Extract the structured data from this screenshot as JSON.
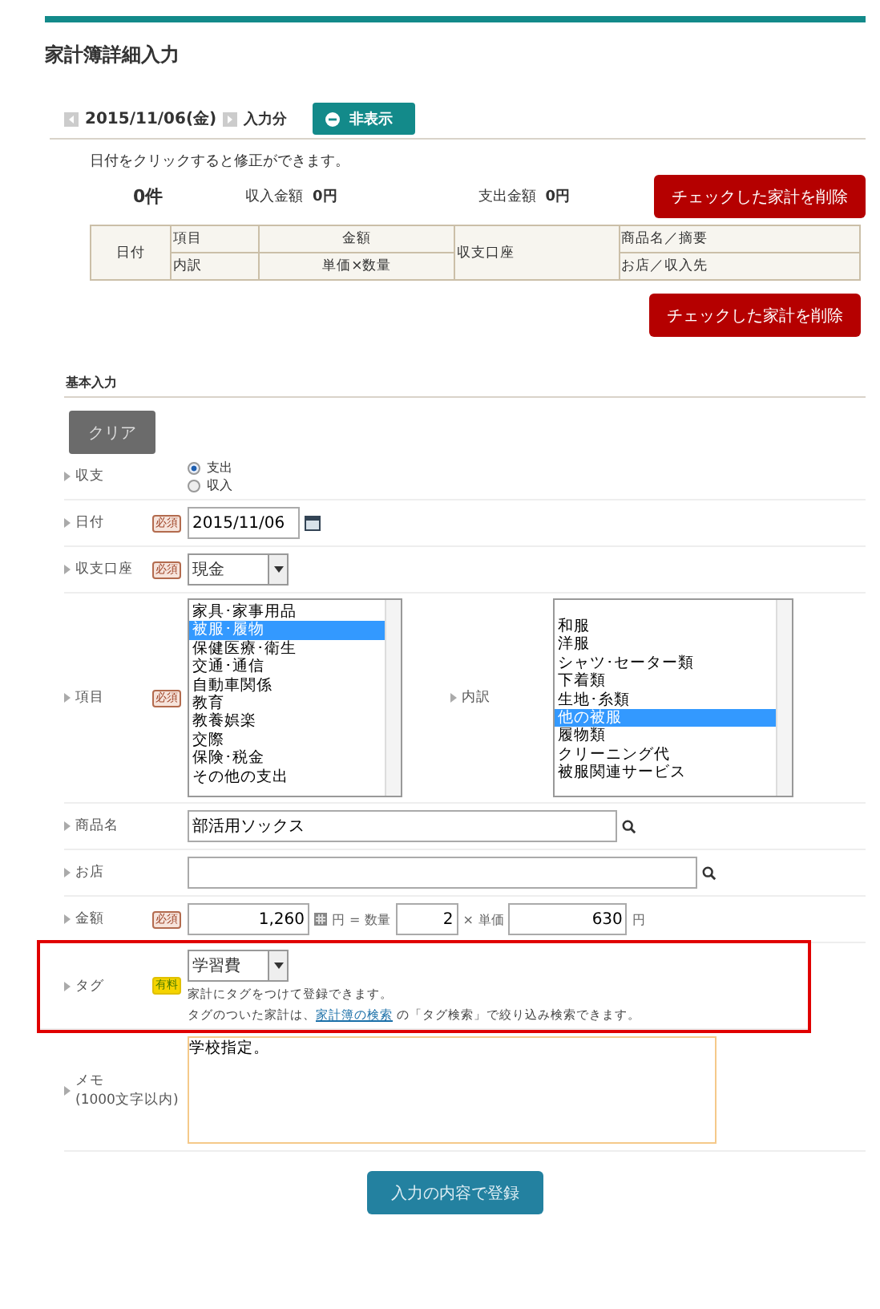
{
  "page": {
    "title": "家計簿詳細入力"
  },
  "summary": {
    "date": "2015/11/06(金)",
    "suffix": "入力分",
    "toggle_button": "非表示",
    "hint": "日付をクリックすると修正ができます。",
    "count": "0件",
    "income_label": "収入金額",
    "income_value": "0円",
    "expense_label": "支出金額",
    "expense_value": "0円",
    "delete_button": "チェックした家計を削除"
  },
  "table": {
    "columns": [
      {
        "label": "日付"
      },
      {
        "top": "項目",
        "bottom": "内訳"
      },
      {
        "top": "金額",
        "bottom": "単価×数量"
      },
      {
        "label": "収支口座"
      },
      {
        "top": "商品名／摘要",
        "bottom": "お店／収入先"
      }
    ]
  },
  "delete_button_bottom": "チェックした家計を削除",
  "form": {
    "section_title": "基本入力",
    "clear_button": "クリア",
    "fields": [
      {
        "kind": "radio",
        "label": "収支",
        "options": [
          {
            "label": "支出",
            "selected": true
          },
          {
            "label": "収入",
            "selected": false
          }
        ]
      },
      {
        "kind": "date",
        "label": "日付",
        "badge": {
          "kind": "required",
          "text": "必須"
        },
        "value": "2015/11/06"
      },
      {
        "kind": "select",
        "label": "収支口座",
        "badge": {
          "kind": "required",
          "text": "必須"
        },
        "value": "現金"
      },
      {
        "kind": "lists",
        "label": "項目",
        "badge": {
          "kind": "required",
          "text": "必須"
        },
        "items": [
          {
            "label": "家具･家事用品",
            "selected": false
          },
          {
            "label": "被服･履物",
            "selected": true
          },
          {
            "label": "保健医療･衛生",
            "selected": false
          },
          {
            "label": "交通･通信",
            "selected": false
          },
          {
            "label": "自動車関係",
            "selected": false
          },
          {
            "label": "教育",
            "selected": false
          },
          {
            "label": "教養娯楽",
            "selected": false
          },
          {
            "label": "交際",
            "selected": false
          },
          {
            "label": "保険･税金",
            "selected": false
          },
          {
            "label": "その他の支出",
            "selected": false
          }
        ],
        "sub_label": "内訳",
        "sub_items": [
          {
            "label": "和服",
            "selected": false
          },
          {
            "label": "洋服",
            "selected": false
          },
          {
            "label": "シャツ･セーター類",
            "selected": false
          },
          {
            "label": "下着類",
            "selected": false
          },
          {
            "label": "生地･糸類",
            "selected": false
          },
          {
            "label": "他の被服",
            "selected": true
          },
          {
            "label": "履物類",
            "selected": false
          },
          {
            "label": "クリーニング代",
            "selected": false
          },
          {
            "label": "被服関連サービス",
            "selected": false
          }
        ]
      },
      {
        "kind": "product",
        "label": "商品名",
        "value": "部活用ソックス"
      },
      {
        "kind": "shop",
        "label": "お店"
      },
      {
        "kind": "amount",
        "label": "金額",
        "badge": {
          "kind": "required",
          "text": "必須"
        },
        "total": "1,260",
        "yen": "円",
        "equals": "=",
        "quantity_label": "数量",
        "quantity": "2",
        "times": "×",
        "unit_label": "単価",
        "unit_price": "630",
        "yen2": "円"
      },
      {
        "kind": "tag",
        "label": "タグ",
        "badge": {
          "kind": "paid",
          "text": "有料"
        },
        "highlighted": true,
        "value": "学習費",
        "note1": "家計にタグをつけて登録できます。",
        "note2_before": "タグのついた家計は、",
        "note2_link": "家計簿の検索",
        "note2_after": "の「タグ検索」で絞り込み検索できます。"
      },
      {
        "kind": "memo",
        "label": "メモ",
        "sub": "(1000文字以内)",
        "value": "学校指定。"
      }
    ]
  },
  "submit_button": "入力の内容で登録"
}
